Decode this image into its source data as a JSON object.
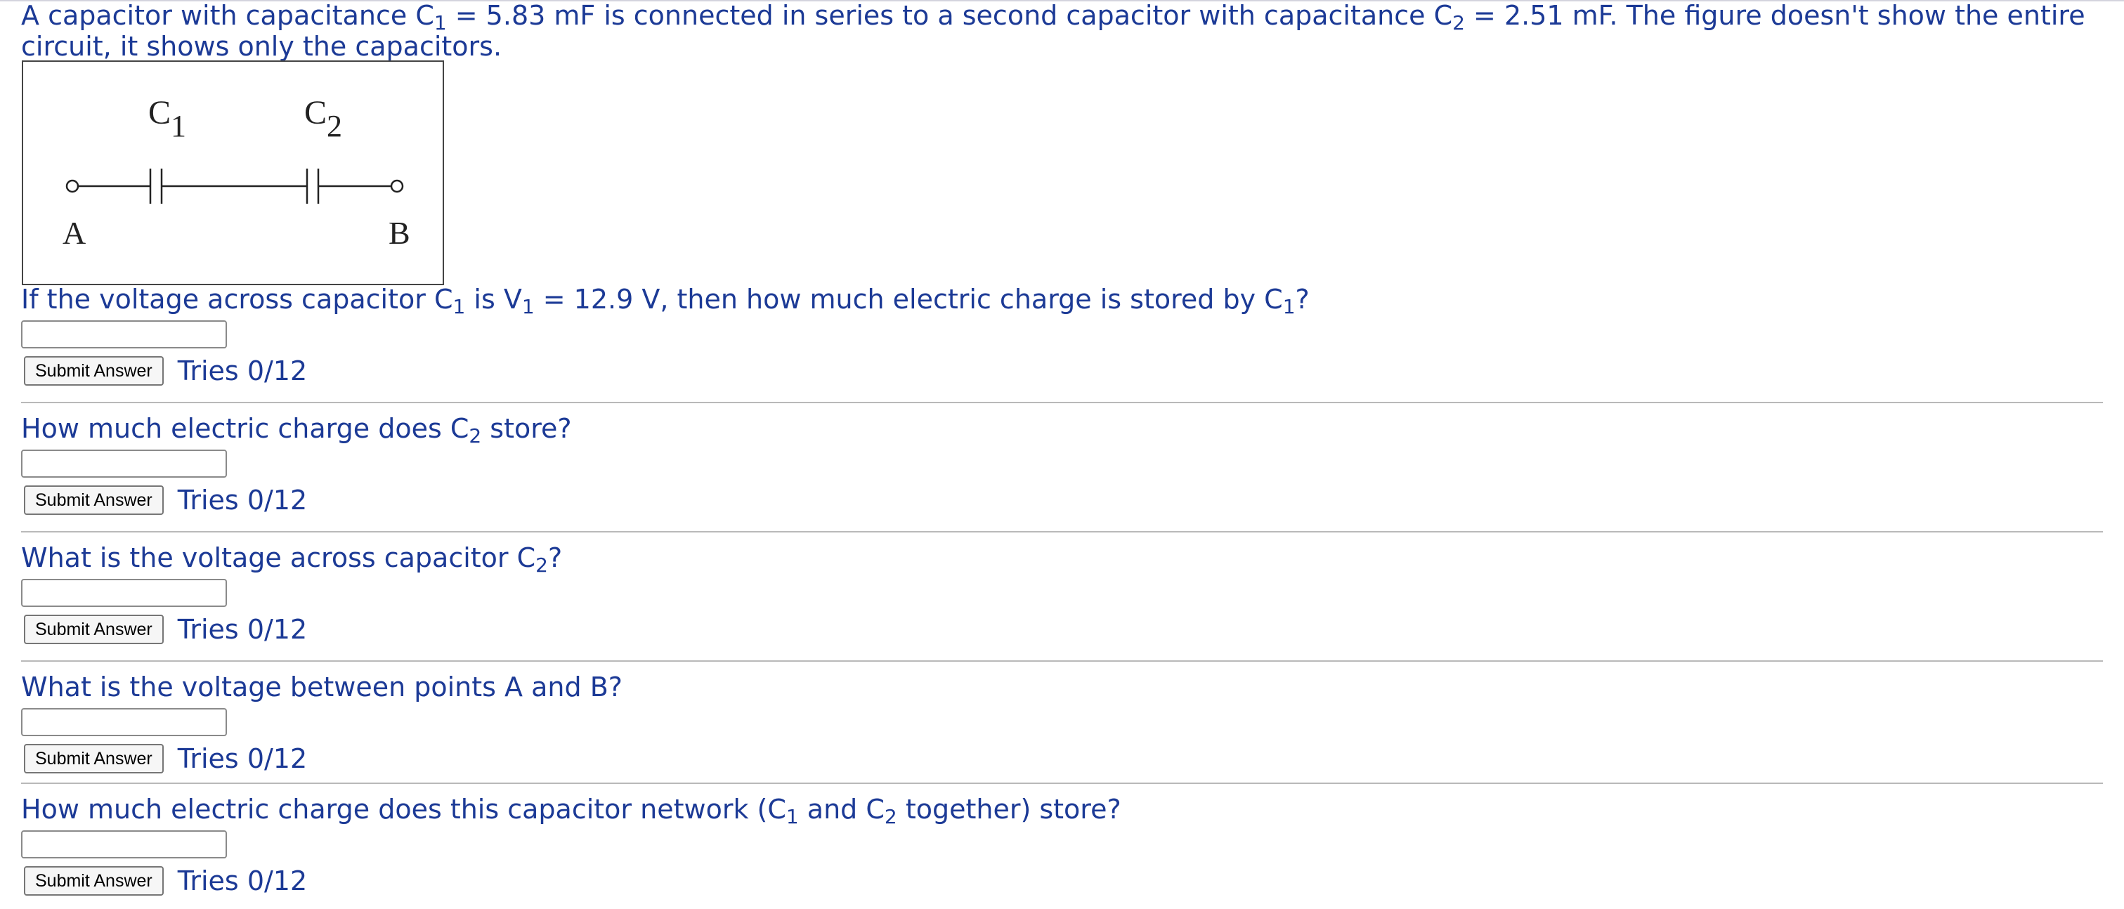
{
  "intro": {
    "p1": "A capacitor with capacitance C",
    "s1": "1",
    "p2": " = 5.83 mF is connected in series to a second capacitor with capacitance C",
    "s2": "2",
    "p3": " = 2.51 mF. The figure doesn't show the entire circuit, it shows only the capacitors."
  },
  "figure": {
    "c1_letter": "C",
    "c1_sub": "1",
    "c2_letter": "C",
    "c2_sub": "2",
    "point_a": "A",
    "point_b": "B"
  },
  "submit_label": "Submit Answer",
  "questions": [
    {
      "p1": "If the voltage across capacitor C",
      "s1": "1",
      "p2": " is V",
      "s2": "1",
      "p3": " = 12.9 V, then how much electric charge is stored by C",
      "s3": "1",
      "p4": "?",
      "input_value": "",
      "tries": "Tries 0/12"
    },
    {
      "p1": "How much electric charge does C",
      "s1": "2",
      "p2": " store?",
      "input_value": "",
      "tries": "Tries 0/12"
    },
    {
      "p1": "What is the voltage across capacitor C",
      "s1": "2",
      "p2": "?",
      "input_value": "",
      "tries": "Tries 0/12"
    },
    {
      "p1": "What is the voltage between points A and B?",
      "input_value": "",
      "tries": "Tries 0/12"
    },
    {
      "p1": "How much electric charge does this capacitor network (C",
      "s1": "1",
      "p2": " and C",
      "s2": "2",
      "p3": " together) store?",
      "input_value": "",
      "tries": "Tries 0/12"
    }
  ],
  "colors": {
    "text": "#1c3a96",
    "divider": "#b9b9b9"
  }
}
